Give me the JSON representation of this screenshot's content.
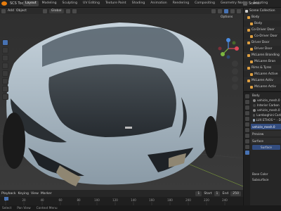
{
  "app": {
    "menu": [
      "SCS Tools"
    ],
    "workspace_tabs": [
      "Layout",
      "Modeling",
      "Sculpting",
      "UV Editing",
      "Texture Paint",
      "Shading",
      "Animation",
      "Rendering",
      "Compositing",
      "Geometry Nodes",
      "Scripting"
    ],
    "active_tab": "Layout",
    "scene_label": "Scene"
  },
  "viewport_header": {
    "items": [
      "Add",
      "Object"
    ],
    "orientation": "Global",
    "options": "Options"
  },
  "outliner": {
    "title": "Scene Collection",
    "rows": [
      {
        "label": "Scene Collection",
        "color": "#cccccc"
      },
      {
        "label": "Body",
        "color": "#e0a040"
      },
      {
        "label": "Body",
        "color": "#e0a040"
      },
      {
        "label": "Co-Driver Door",
        "color": "#e0a040"
      },
      {
        "label": "Co-Driver Door",
        "color": "#e0a040"
      },
      {
        "label": "Driver Door",
        "color": "#e0a040"
      },
      {
        "label": "Driver Door",
        "color": "#e0a040"
      },
      {
        "label": "McLaren Branding",
        "color": "#e0a040"
      },
      {
        "label": "McLaren Bran",
        "color": "#e0a040"
      },
      {
        "label": "Rims & Tyres",
        "color": "#e0a040"
      },
      {
        "label": "McLaren Active",
        "color": "#e0a040"
      },
      {
        "label": "McLaren Activ",
        "color": "#e0a040"
      },
      {
        "label": "McLaren Activ",
        "color": "#e0a040"
      }
    ]
  },
  "properties": {
    "object_label": "Body",
    "material_slots": [
      {
        "label": "vehicle_mesh.0",
        "color": "#8a8a8a"
      },
      {
        "label": "Interior Carbon",
        "color": "#444444"
      },
      {
        "label": "vehicle_mesh.0",
        "color": "#8a8a8a"
      },
      {
        "label": "Lamboghini Carb",
        "color": "#555555"
      },
      {
        "label": "LUX ETHOS™ - Di",
        "color": "#9fb0c0"
      }
    ],
    "selected_material": "vehicle_mesh.0",
    "sections": [
      "Preview",
      "Surface"
    ],
    "surface_button": "Surface",
    "base_color_label": "Base Color",
    "subsurface_label": "Subsurface"
  },
  "timeline": {
    "playback": "Playback",
    "keying": "Keying",
    "view": "View",
    "marker": "Marker",
    "current_frame": "1",
    "start_label": "Start",
    "start_value": "1",
    "end_label": "End",
    "end_value": "250",
    "ticks": [
      "0",
      "20",
      "40",
      "60",
      "80",
      "100",
      "120",
      "140",
      "160",
      "180",
      "200",
      "220",
      "240"
    ]
  },
  "statusbar": {
    "items": [
      "Select",
      "Pan View",
      "Context Menu"
    ]
  }
}
